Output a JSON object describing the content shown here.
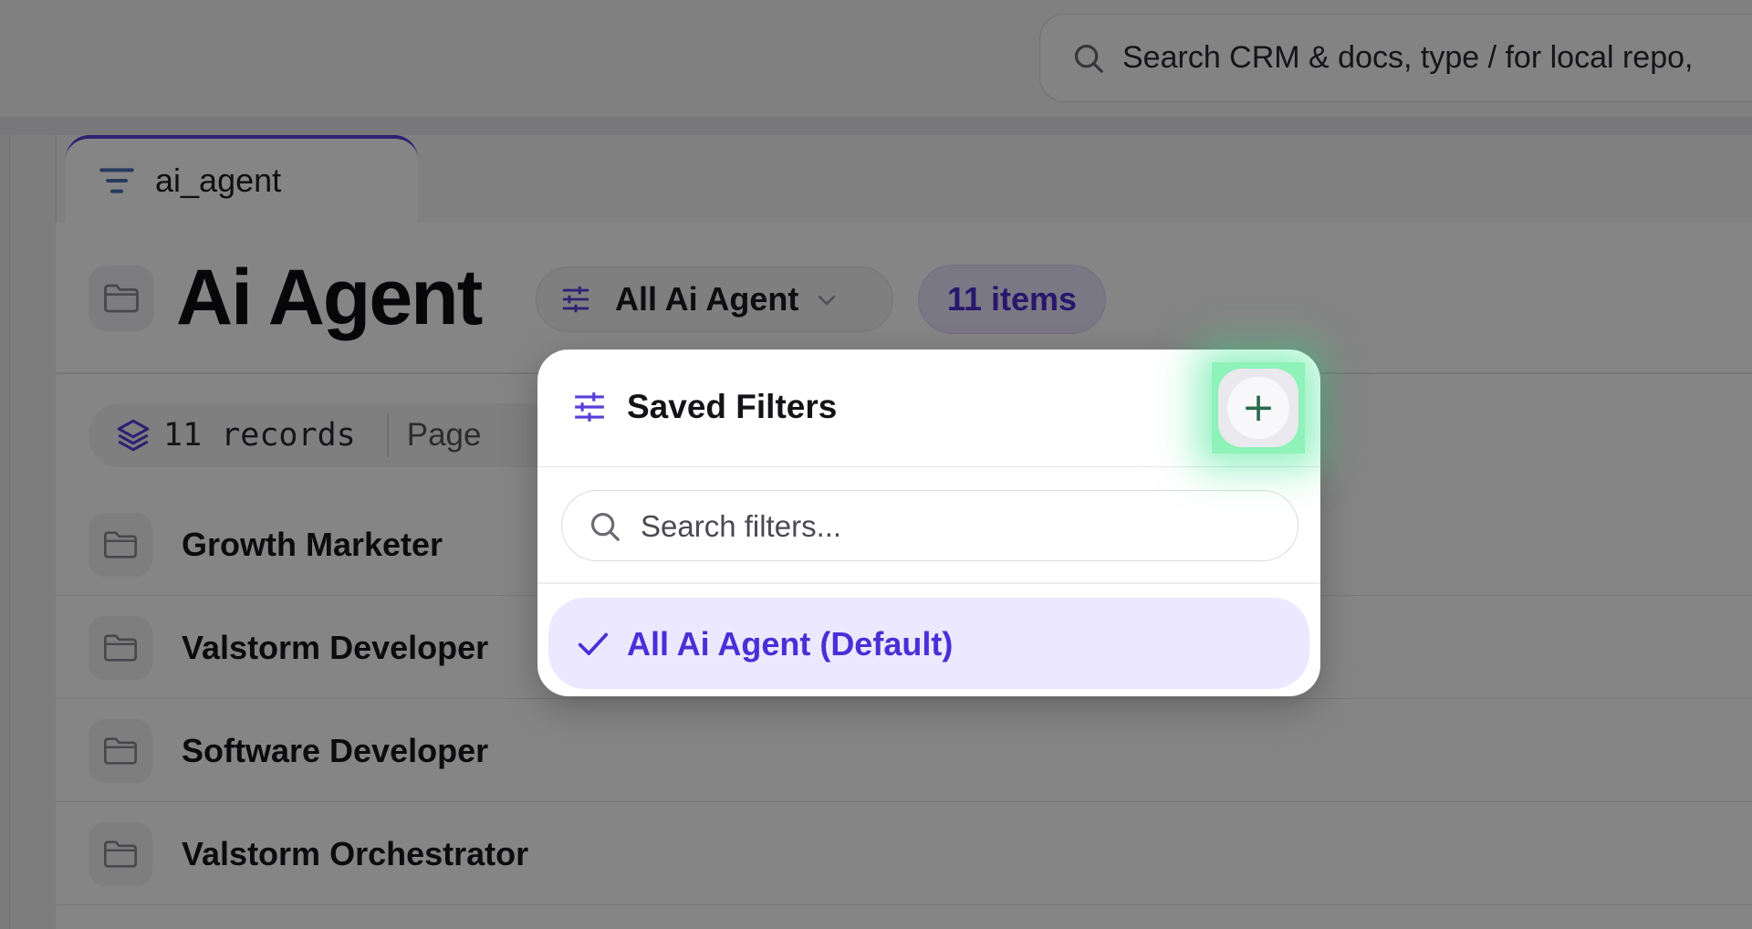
{
  "search": {
    "text": "Search CRM & docs, type / for local repo,"
  },
  "tab": {
    "label": "ai_agent"
  },
  "header": {
    "title": "Ai Agent",
    "filter_label": "All Ai Agent",
    "items_badge": "11 items"
  },
  "toolbar": {
    "records": "11 records",
    "page_label": "Page"
  },
  "rows": [
    {
      "name": "Growth Marketer"
    },
    {
      "name": "Valstorm Developer"
    },
    {
      "name": "Software Developer"
    },
    {
      "name": "Valstorm Orchestrator"
    }
  ],
  "dropdown": {
    "title": "Saved Filters",
    "add_symbol": "+",
    "search_placeholder": "Search filters...",
    "options": [
      {
        "label": "All Ai Agent (Default)",
        "selected": true
      }
    ]
  },
  "colors": {
    "accent": "#4b2fd0",
    "highlight": "#8ff2b8",
    "selected_bg": "#ece8ff"
  }
}
